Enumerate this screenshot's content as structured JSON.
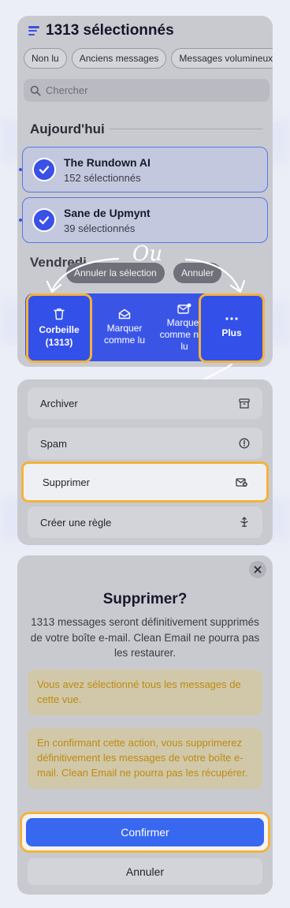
{
  "header": {
    "title": "1313 sélectionnés"
  },
  "chips": [
    "Non lu",
    "Anciens messages",
    "Messages volumineux"
  ],
  "search": {
    "placeholder": "Chercher"
  },
  "sections": {
    "today": "Aujourd'hui",
    "friday": "Vendredi"
  },
  "groups": [
    {
      "name": "The Rundown AI",
      "count": "152 sélectionnés"
    },
    {
      "name": "Sane de Upmynt",
      "count": "39 sélectionnés"
    }
  ],
  "pills": {
    "deselect": "Annuler la sélection",
    "cancel": "Annuler"
  },
  "annotation": {
    "or": "Ou"
  },
  "actions": {
    "trash": {
      "label": "Corbeille",
      "count": "(1313)"
    },
    "mark_read": {
      "line1": "Marquer",
      "line2": "comme lu"
    },
    "mark_unread": {
      "line1": "Marquer",
      "line2": "comme non",
      "line3": "lu"
    },
    "more": {
      "label": "Plus"
    }
  },
  "menu": {
    "items": [
      "Archiver",
      "Spam",
      "Supprimer",
      "Créer une règle"
    ],
    "icons": [
      "archive-icon",
      "spam-icon",
      "delete-mail-icon",
      "rule-icon"
    ]
  },
  "dialog": {
    "title": "Supprimer?",
    "body": "1313 messages seront définitivement supprimés de votre boîte e-mail. Clean Email ne pourra pas les restaurer.",
    "warning1": "Vous avez sélectionné tous les messages de cette vue.",
    "warning2": "En confirmant cette action, vous supprimerez définitivement les messages de votre boîte e-mail. Clean Email ne pourra pas les récupérer.",
    "confirm": "Confirmer",
    "cancel": "Annuler"
  },
  "colors": {
    "accent": "#3a55e6",
    "highlight": "#f3b33a",
    "warning_text": "#c08a10",
    "confirm": "#3867f0"
  }
}
